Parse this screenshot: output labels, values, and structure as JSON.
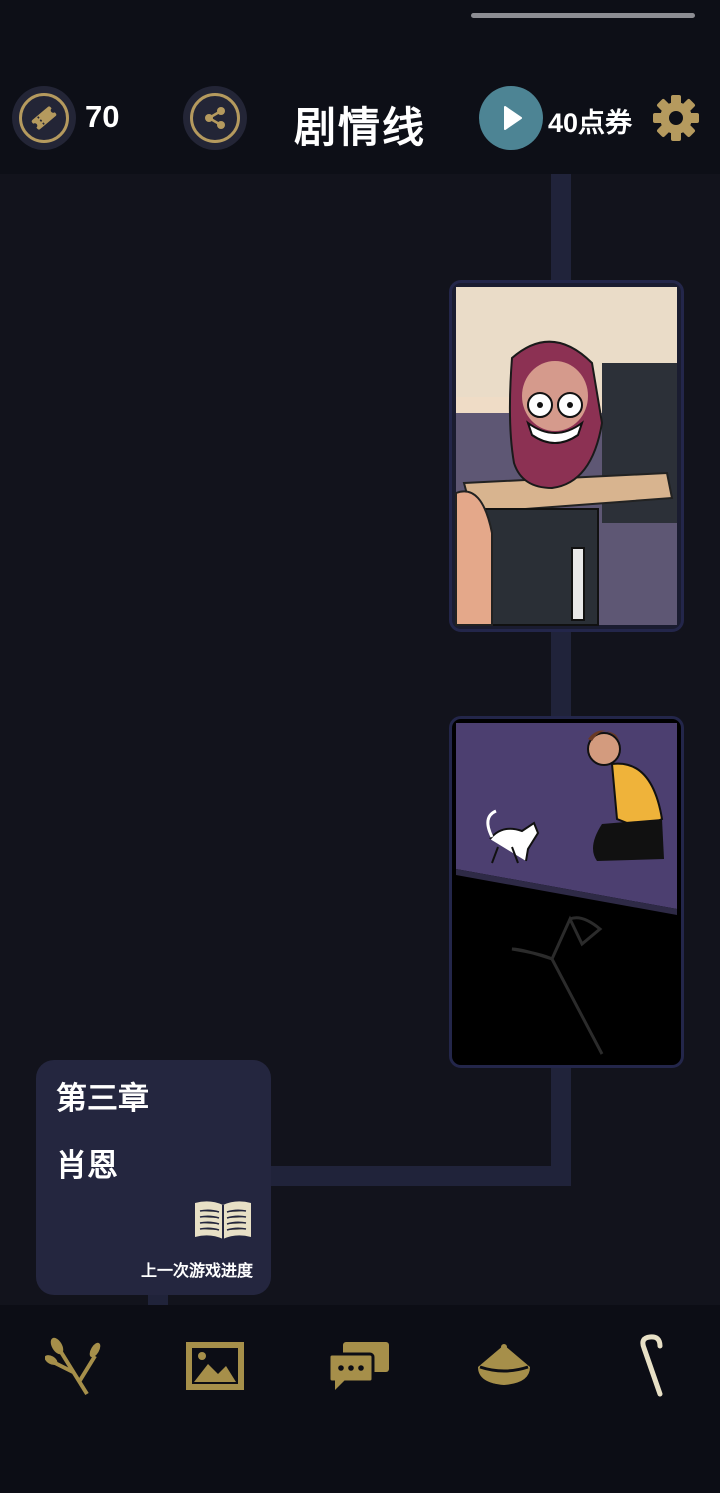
{
  "header": {
    "ticket_count": "70",
    "title": "剧情线",
    "points_label": "40点券"
  },
  "chapter": {
    "number": "第三章",
    "name": "肖恩",
    "progress_label": "上一次游戏进度"
  },
  "icons": {
    "ticket": "ticket-icon",
    "share": "share-icon",
    "play": "play-icon",
    "settings": "gear-icon",
    "book": "book-icon",
    "nav": [
      "branch-icon",
      "gallery-icon",
      "chat-icon",
      "hat-icon",
      "cane-icon"
    ]
  },
  "colors": {
    "background": "#12131c",
    "header": "#0d0f17",
    "gold_accent": "#b59a5e",
    "play_button": "#4d8494",
    "card": "#24263f",
    "nav_icon": "#a68f4a"
  }
}
